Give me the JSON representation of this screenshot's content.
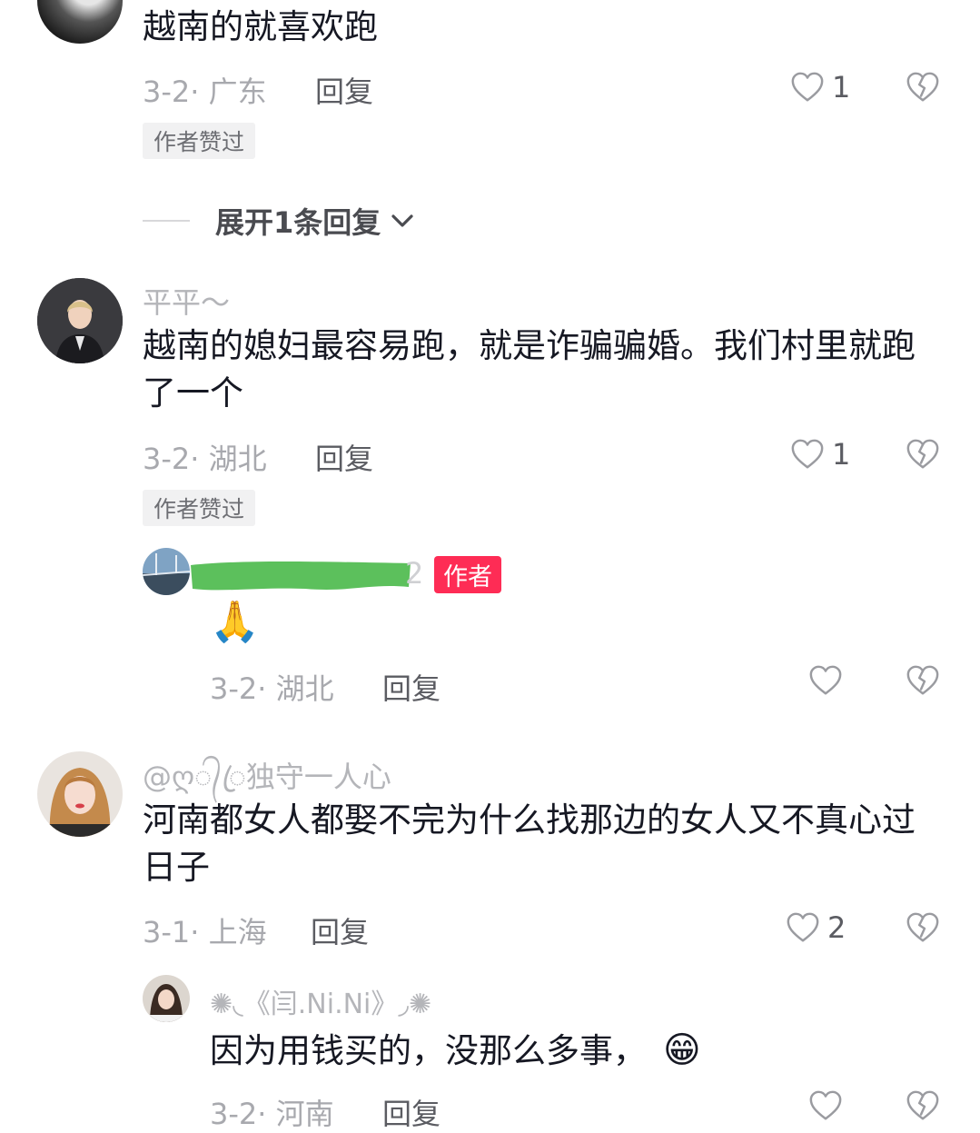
{
  "comments": [
    {
      "text": "越南的就喜欢跑",
      "date": "3-2",
      "location": "广东",
      "reply_label": "回复",
      "likes": "1",
      "badge": "作者赞过",
      "expand_label": "展开1条回复"
    },
    {
      "username": "平平～",
      "text": "越南的媳妇最容易跑，就是诈骗骗婚。我们村里就跑了一个",
      "date": "3-2",
      "location": "湖北",
      "reply_label": "回复",
      "likes": "1",
      "badge": "作者赞过",
      "reply": {
        "username_visible_suffix": "2",
        "author_badge": "作者",
        "emoji": "🙏",
        "date": "3-2",
        "location": "湖北",
        "reply_label": "回复"
      }
    },
    {
      "username": "@ღ᭄ꦿ独守一人心",
      "text": "河南都女人都娶不完为什么找那边的女人又不真心过日子",
      "date": "3-1",
      "location": "上海",
      "reply_label": "回复",
      "likes": "2",
      "reply": {
        "username": "✺◟《闫.Ni.Ni》◞✺",
        "text": "因为用钱买的，没那么多事，",
        "emoji": "😁",
        "date": "3-2",
        "location": "河南",
        "reply_label": "回复"
      }
    }
  ],
  "icons": {
    "like": "heart-outline-icon",
    "dislike": "broken-heart-icon",
    "expand": "chevron-down-icon"
  },
  "colors": {
    "author_badge": "#fe2c55",
    "redaction": "#5cc05c"
  }
}
